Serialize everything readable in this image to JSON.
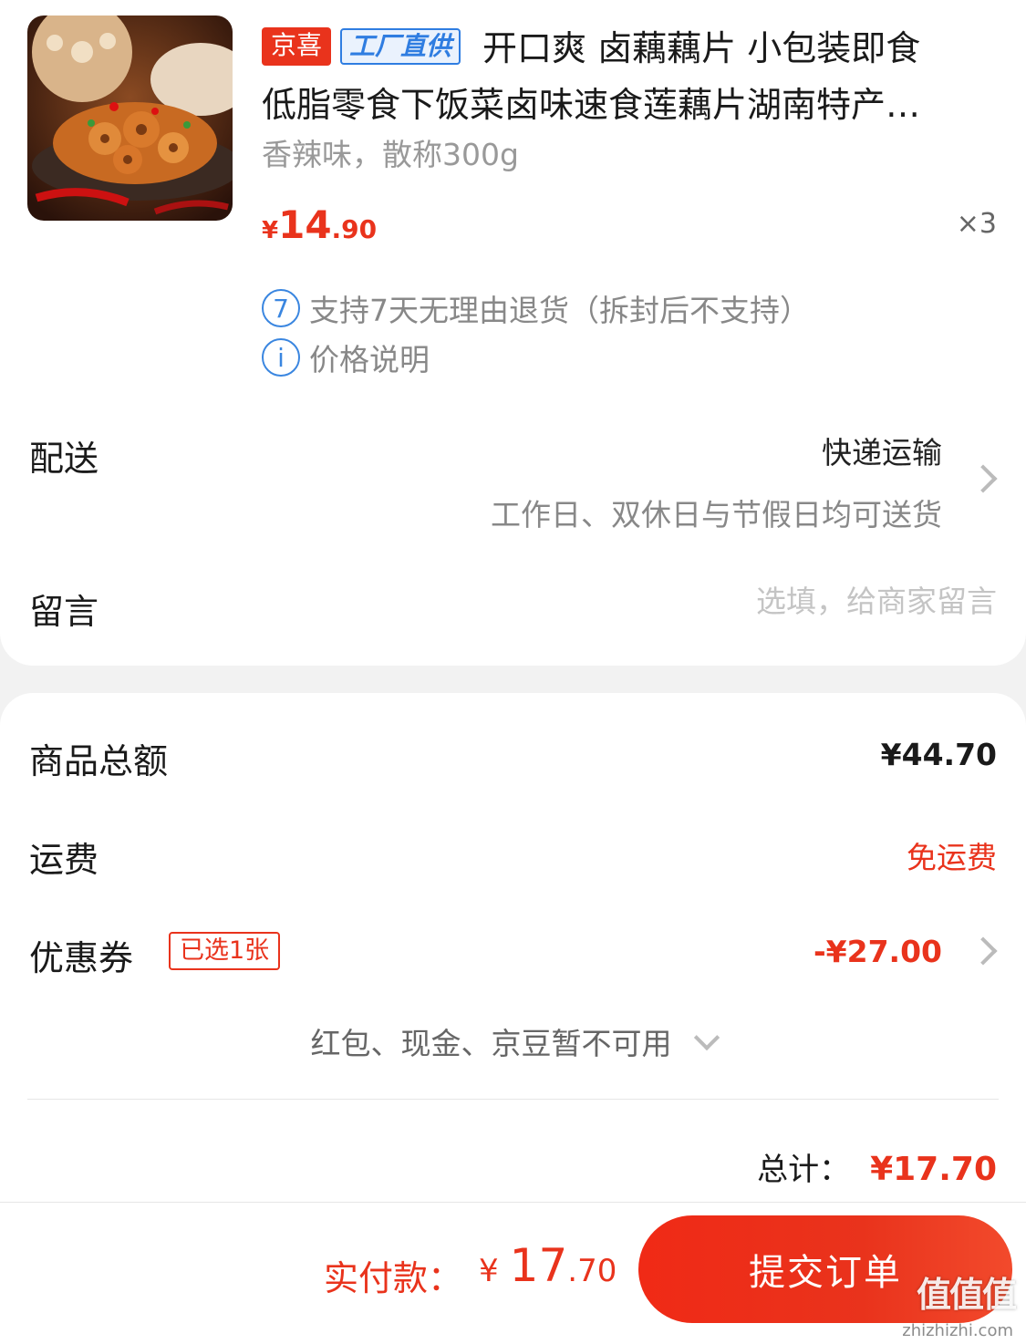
{
  "product": {
    "tags": {
      "jingxi": "京喜",
      "factory": "工厂直供"
    },
    "title_line1": "开口爽 卤藕藕片 小包装即食",
    "title_line2": "低脂零食下饭菜卤味速食莲藕片湖南特产…",
    "spec": "香辣味，散称300g",
    "price": {
      "symbol": "¥",
      "integer": "14",
      "decimal": ".90"
    },
    "quantity": "×3",
    "services": [
      {
        "icon_text": "7",
        "icon": "seven-day-icon",
        "label": "支持7天无理由退货（拆封后不支持）"
      },
      {
        "icon_text": "i",
        "icon": "info-icon",
        "label": "价格说明"
      }
    ]
  },
  "delivery": {
    "label": "配送",
    "method": "快递运输",
    "note": "工作日、双休日与节假日均可送货"
  },
  "message": {
    "label": "留言",
    "placeholder": "选填，给商家留言",
    "value": ""
  },
  "summary": {
    "goods_label": "商品总额",
    "goods_value": "¥44.70",
    "shipping_label": "运费",
    "shipping_value": "免运费",
    "coupon_label": "优惠券",
    "coupon_badge": "已选1张",
    "coupon_value": "-¥27.00",
    "unavailable": "红包、现金、京豆暂不可用",
    "total_label": "总计：",
    "total_value": "¥17.70"
  },
  "footer": {
    "pay_label": "实付款：",
    "pay_symbol": "¥",
    "pay_integer": "17",
    "pay_decimal": ".70",
    "submit_label": "提交订单"
  },
  "watermark": {
    "text": "值值值",
    "url": "zhizhizhi.com"
  },
  "colors": {
    "accent": "#e9331c",
    "link_blue": "#2f7de1"
  }
}
